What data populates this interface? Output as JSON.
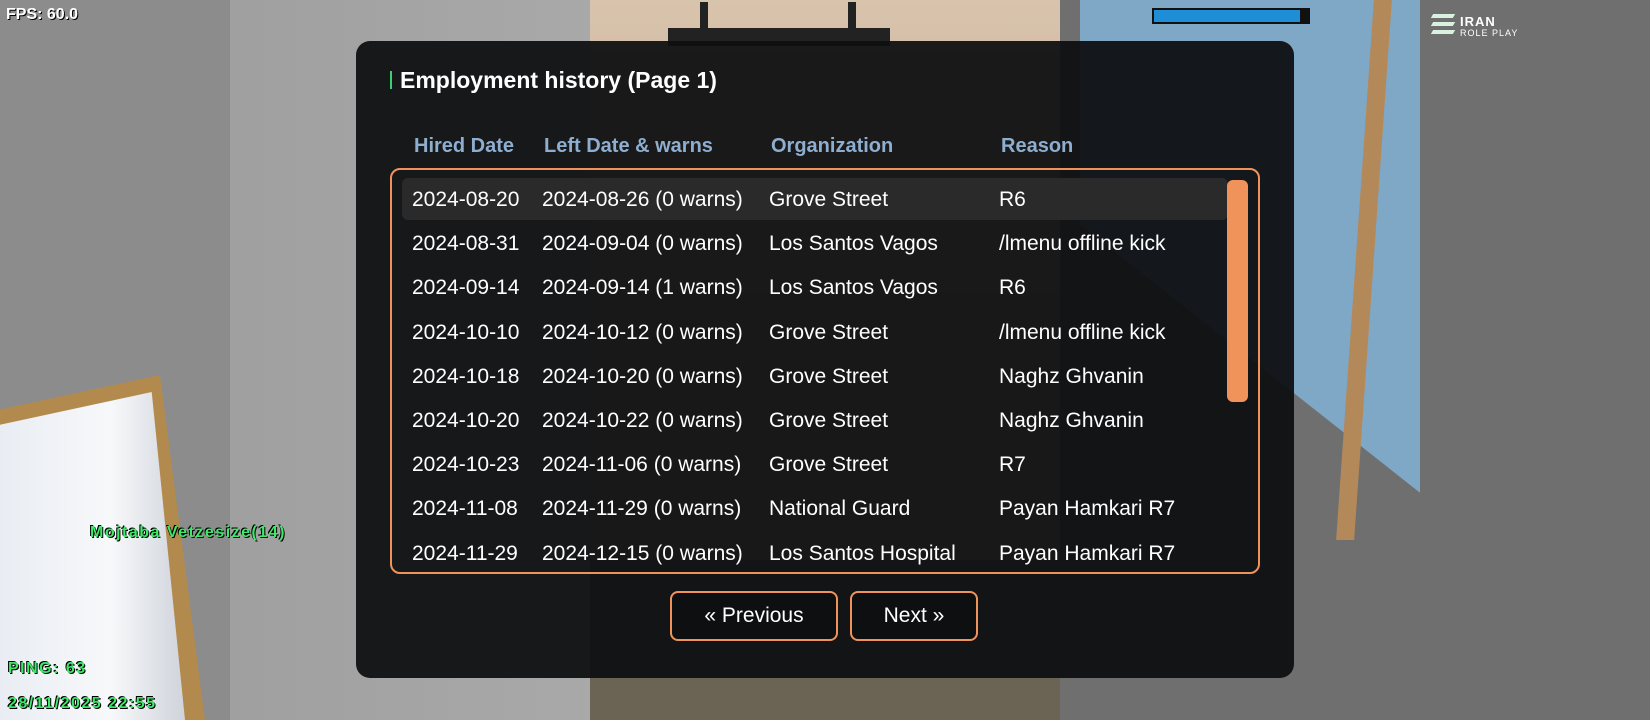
{
  "hud": {
    "fps": "FPS: 60.0",
    "health_fraction": 0.95,
    "logo_line1": "IRAN",
    "logo_line2": "ROLE PLAY",
    "player_name": "Mojtaba Vetzesize(14)",
    "ping": "PING: 63",
    "datetime": "28/11/2025 22:55"
  },
  "dialog": {
    "title": "Employment history (Page 1)",
    "columns": {
      "hired": "Hired Date",
      "left": "Left Date & warns",
      "org": "Organization",
      "reason": "Reason"
    },
    "rows": [
      {
        "hired": "2024-08-20",
        "left": "2024-08-26 (0 warns)",
        "org": "Grove Street",
        "reason": "R6",
        "selected": true
      },
      {
        "hired": "2024-08-31",
        "left": "2024-09-04 (0 warns)",
        "org": "Los Santos Vagos",
        "reason": "/lmenu offline kick"
      },
      {
        "hired": "2024-09-14",
        "left": "2024-09-14 (1 warns)",
        "org": "Los Santos Vagos",
        "reason": "R6"
      },
      {
        "hired": "2024-10-10",
        "left": "2024-10-12 (0 warns)",
        "org": "Grove Street",
        "reason": "/lmenu offline kick"
      },
      {
        "hired": "2024-10-18",
        "left": "2024-10-20 (0 warns)",
        "org": "Grove Street",
        "reason": "Naghz Ghvanin"
      },
      {
        "hired": "2024-10-20",
        "left": "2024-10-22 (0 warns)",
        "org": "Grove Street",
        "reason": "Naghz Ghvanin"
      },
      {
        "hired": "2024-10-23",
        "left": "2024-11-06 (0 warns)",
        "org": "Grove Street",
        "reason": "R7"
      },
      {
        "hired": "2024-11-08",
        "left": "2024-11-29 (0 warns)",
        "org": "National Guard",
        "reason": "Payan Hamkari R7"
      },
      {
        "hired": "2024-11-29",
        "left": "2024-12-15 (0 warns)",
        "org": "Los Santos Hospital",
        "reason": "Payan Hamkari R7"
      }
    ],
    "prev_label": "« Previous",
    "next_label": "Next »"
  },
  "colors": {
    "accent": "#f0935a",
    "header_text": "#8eaed0",
    "title_marker": "#3cd070",
    "hud_green": "#3ee86a",
    "health": "#1e8fd6"
  }
}
